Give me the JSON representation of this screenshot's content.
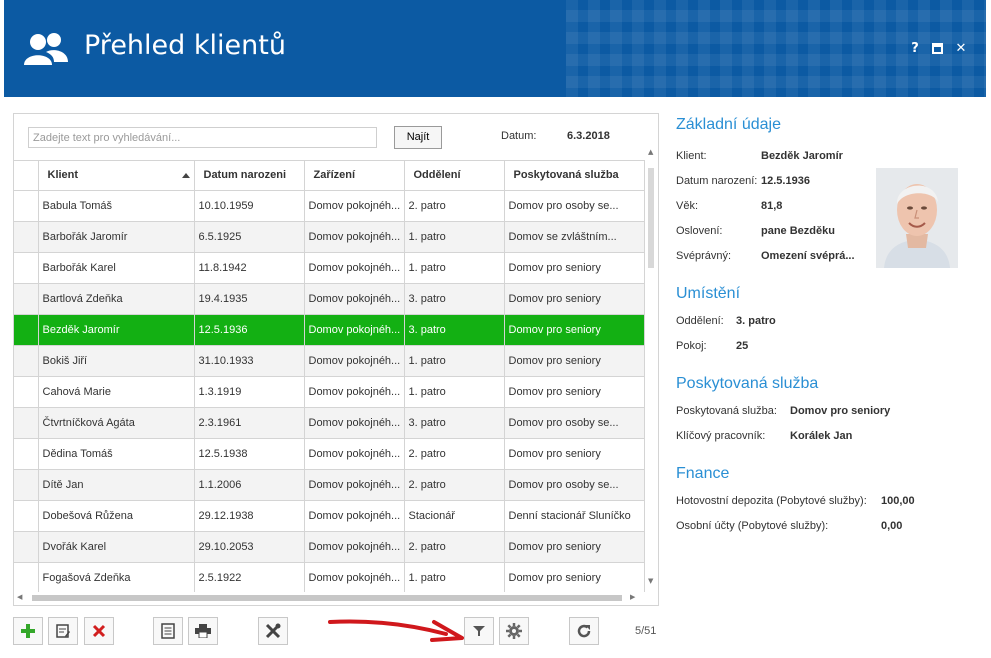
{
  "window": {
    "title": "Přehled klientů",
    "controls": [
      "?",
      "□",
      "✕"
    ]
  },
  "search": {
    "placeholder": "Zadejte text pro vyhledávání...",
    "value": "",
    "find_label": "Najít",
    "date_label": "Datum:",
    "date_value": "6.3.2018"
  },
  "table": {
    "columns": [
      "Klient",
      "Datum narozeni",
      "Zařízení",
      "Oddělení",
      "Poskytovaná služba"
    ],
    "sorted_column": "Klient",
    "sort_direction": "ascending",
    "rows": [
      {
        "klient": "Babula Tomáš",
        "datum": "10.10.1959",
        "zarizeni": "Domov pokojnéh...",
        "oddeleni": "2. patro",
        "sluzba": "Domov pro osoby se..."
      },
      {
        "klient": "Barbořák Jaromír",
        "datum": "6.5.1925",
        "zarizeni": "Domov pokojnéh...",
        "oddeleni": "1. patro",
        "sluzba": "Domov se zvláštním..."
      },
      {
        "klient": "Barbořák Karel",
        "datum": "11.8.1942",
        "zarizeni": "Domov pokojnéh...",
        "oddeleni": "1. patro",
        "sluzba": "Domov pro seniory"
      },
      {
        "klient": "Bartlová Zdeňka",
        "datum": "19.4.1935",
        "zarizeni": "Domov pokojnéh...",
        "oddeleni": "3. patro",
        "sluzba": "Domov pro seniory"
      },
      {
        "klient": "Bezděk Jaromír",
        "datum": "12.5.1936",
        "zarizeni": "Domov pokojnéh...",
        "oddeleni": "3. patro",
        "sluzba": "Domov pro seniory",
        "selected": true
      },
      {
        "klient": "Bokiš Jiří",
        "datum": "31.10.1933",
        "zarizeni": "Domov pokojnéh...",
        "oddeleni": "1. patro",
        "sluzba": "Domov pro seniory"
      },
      {
        "klient": "Cahová Marie",
        "datum": "1.3.1919",
        "zarizeni": "Domov pokojnéh...",
        "oddeleni": "1. patro",
        "sluzba": "Domov pro seniory"
      },
      {
        "klient": "Čtvrtníčková Agáta",
        "datum": "2.3.1961",
        "zarizeni": "Domov pokojnéh...",
        "oddeleni": "3. patro",
        "sluzba": "Domov pro osoby se..."
      },
      {
        "klient": "Dědina Tomáš",
        "datum": "12.5.1938",
        "zarizeni": "Domov pokojnéh...",
        "oddeleni": "2. patro",
        "sluzba": "Domov pro seniory"
      },
      {
        "klient": "Dítě Jan",
        "datum": "1.1.2006",
        "zarizeni": "Domov pokojnéh...",
        "oddeleni": "2. patro",
        "sluzba": "Domov pro osoby se..."
      },
      {
        "klient": "Dobešová Růžena",
        "datum": "29.12.1938",
        "zarizeni": "Domov pokojnéh...",
        "oddeleni": "Stacionář",
        "sluzba": "Denní stacionář Sluníčko"
      },
      {
        "klient": "Dvořák Karel",
        "datum": "29.10.2053",
        "zarizeni": "Domov pokojnéh...",
        "oddeleni": "2. patro",
        "sluzba": "Domov pro seniory"
      },
      {
        "klient": "Fogašová Zdeňka",
        "datum": "2.5.1922",
        "zarizeni": "Domov pokojnéh...",
        "oddeleni": "1. patro",
        "sluzba": "Domov pro seniory"
      }
    ]
  },
  "toolbar": {
    "buttons": [
      "add-icon",
      "edit-icon",
      "delete-icon",
      "document-icon",
      "print-icon",
      "tools-icon",
      "filter-icon",
      "settings-gear-icon",
      "refresh-icon"
    ],
    "pager": "5/51"
  },
  "details": {
    "basic": {
      "title": "Základní údaje",
      "client_label": "Klient:",
      "client_value": "Bezděk Jaromír",
      "birth_label": "Datum narození:",
      "birth_value": "12.5.1936",
      "age_label": "Věk:",
      "age_value": "81,8",
      "salutation_label": "Oslovení:",
      "salutation_value": "pane Bezděku",
      "competent_label": "Svéprávný:",
      "competent_value": "Omezení svéprá..."
    },
    "placement": {
      "title": "Umístění",
      "dept_label": "Oddělení:",
      "dept_value": "3. patro",
      "room_label": "Pokoj:",
      "room_value": "25"
    },
    "service": {
      "title": "Poskytovaná služba",
      "service_label": "Poskytovaná služba:",
      "service_value": "Domov pro seniory",
      "worker_label": "Klíčový pracovník:",
      "worker_value": "Korálek Jan"
    },
    "finance": {
      "title": "Fnance",
      "deposit_label": "Hotovostní depozita (Pobytové služby):",
      "deposit_value": "100,00",
      "accounts_label": "Osobní účty (Pobytové služby):",
      "accounts_value": "0,00"
    }
  },
  "colors": {
    "header_bg": "#0c5aa3",
    "selected_row": "#13b013",
    "section_title": "#2a8fd4",
    "annotation_arrow": "#d0181c"
  }
}
